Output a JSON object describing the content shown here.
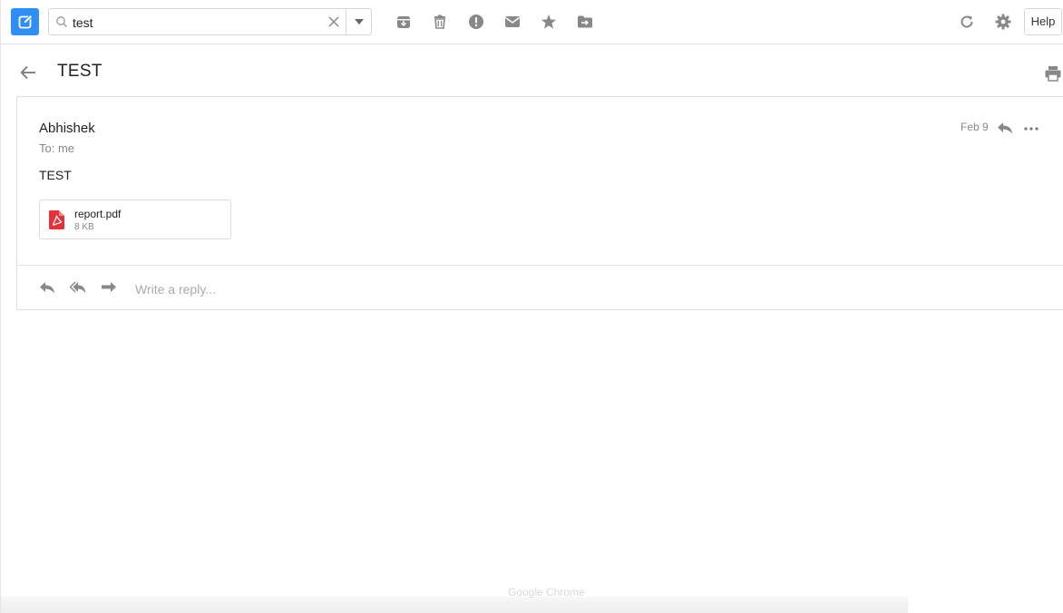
{
  "toolbar": {
    "search": {
      "value": "test",
      "placeholder": ""
    },
    "icons": [
      "compose-icon",
      "search-icon",
      "clear-icon",
      "dropdown-icon",
      "archive-icon",
      "trash-icon",
      "spam-icon",
      "mark-unread-icon",
      "star-icon",
      "move-to-folder-icon",
      "refresh-icon",
      "gear-icon"
    ],
    "help_label": "Help",
    "accent_color": "#2f8ef4"
  },
  "header": {
    "subject": "TEST"
  },
  "message": {
    "sender": "Abhishek",
    "recipient": "To: me",
    "date": "Feb 9",
    "body": "TEST",
    "attachment": {
      "name": "report.pdf",
      "size": "8 KB",
      "icon": "pdf-icon",
      "icon_color": "#e2333b"
    }
  },
  "reply_bar": {
    "placeholder": "Write a reply..."
  },
  "footer": {
    "faint_label": "Google Chrome"
  }
}
